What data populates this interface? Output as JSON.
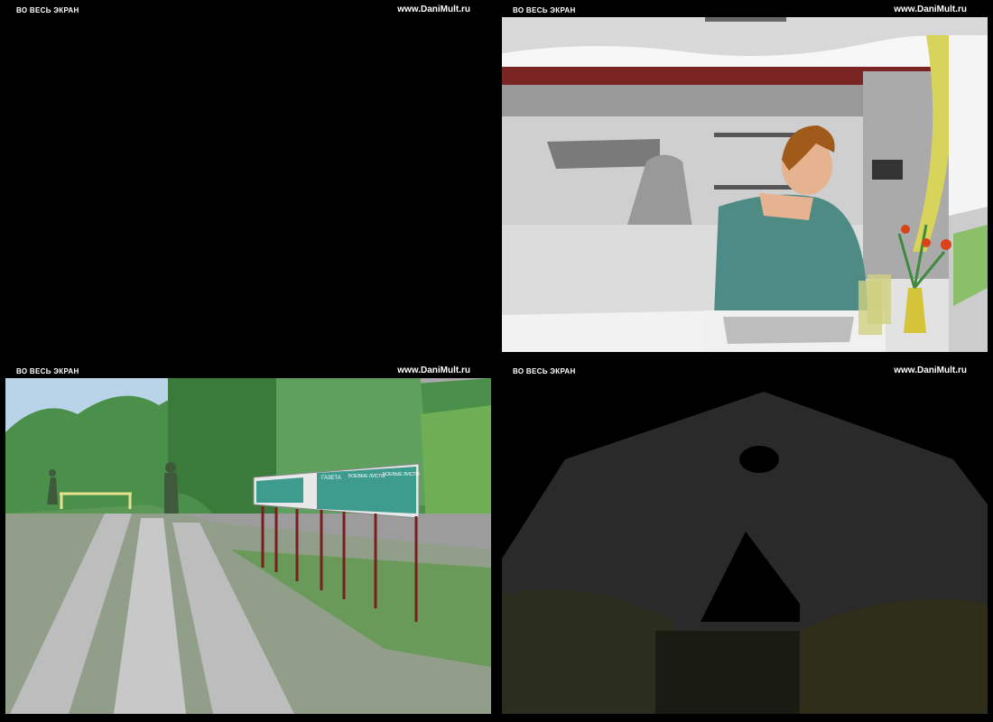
{
  "panels": [
    {
      "fullscreen_label": "ВО ВЕСЬ ЭКРАН",
      "site": "www.DaniMult.ru"
    },
    {
      "fullscreen_label": "ВО ВЕСЬ ЭКРАН",
      "site": "www.DaniMult.ru"
    },
    {
      "fullscreen_label": "ВО ВЕСЬ ЭКРАН",
      "site": "www.DaniMult.ru"
    },
    {
      "fullscreen_label": "ВО ВЕСЬ ЭКРАН",
      "site": "www.DaniMult.ru"
    }
  ],
  "colors": {
    "background": "#000000",
    "label": "#ffffff"
  }
}
